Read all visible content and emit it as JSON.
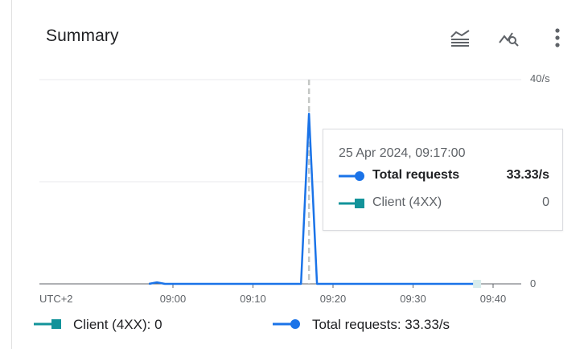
{
  "card": {
    "title": "Summary"
  },
  "toolbar": {
    "icons": [
      "legend-toggle-icon",
      "explore-query-icon",
      "more-vert-icon"
    ]
  },
  "chart_data": {
    "type": "line",
    "timezone_label": "UTC+2",
    "y_ticks": [
      "40/s",
      "0"
    ],
    "ylim": [
      0,
      40
    ],
    "x_ticks": [
      "09:00",
      "09:10",
      "09:20",
      "09:30",
      "09:40"
    ],
    "x_range": [
      "08:58",
      "09:42"
    ],
    "series": [
      {
        "name": "Total requests",
        "color": "#1a73e8",
        "marker": "circle",
        "points": [
          {
            "t": "08:57",
            "v": 0
          },
          {
            "t": "08:58",
            "v": 0.3
          },
          {
            "t": "08:59",
            "v": 0
          },
          {
            "t": "09:16",
            "v": 0
          },
          {
            "t": "09:17",
            "v": 33.33
          },
          {
            "t": "09:18",
            "v": 0
          },
          {
            "t": "09:38",
            "v": 0
          }
        ]
      },
      {
        "name": "Client (4XX)",
        "color": "#12939a",
        "marker": "square",
        "points": [
          {
            "t": "09:38",
            "v": 0
          }
        ]
      }
    ],
    "crosshair_time": "09:17",
    "grid": true
  },
  "tooltip": {
    "time": "25 Apr 2024, 09:17:00",
    "rows": [
      {
        "label": "Total requests",
        "value": "33.33/s"
      },
      {
        "label": "Client (4XX)",
        "value": "0"
      }
    ]
  },
  "legend": [
    {
      "label": "Client (4XX):",
      "value": "0"
    },
    {
      "label": "Total requests:",
      "value": "33.33/s"
    }
  ]
}
